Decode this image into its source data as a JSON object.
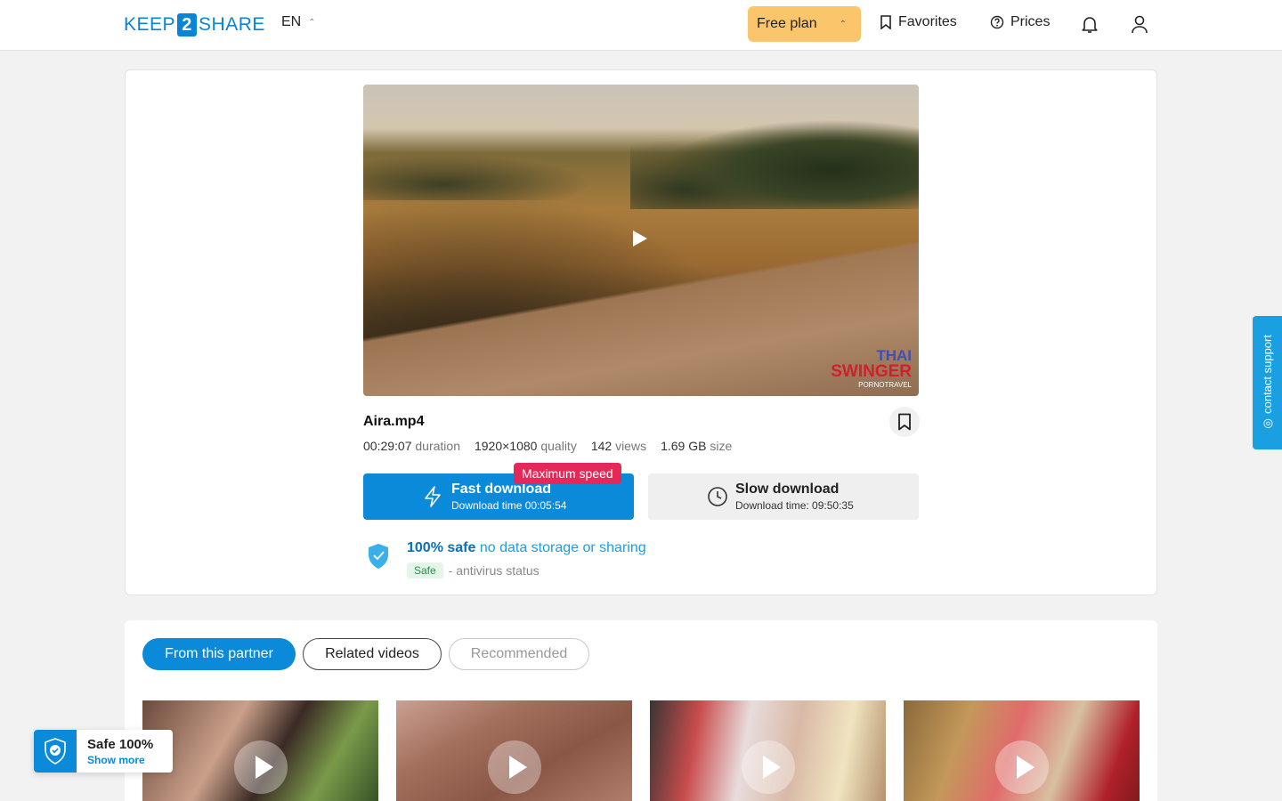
{
  "header": {
    "logo_left": "KEEP",
    "logo_mid": "2",
    "logo_right": "SHARE",
    "language": "EN",
    "plan_label": "Free plan",
    "favorites_label": "Favorites",
    "prices_label": "Prices"
  },
  "video": {
    "watermark_line1": "THAI",
    "watermark_line2": "SWINGER",
    "watermark_line3": "PORNOTRAVEL"
  },
  "file": {
    "name": "Aira.mp4",
    "duration": "00:29:07",
    "duration_label": "duration",
    "quality": "1920×1080",
    "quality_label": "quality",
    "views": "142",
    "views_label": "views",
    "size": "1.69 GB",
    "size_label": "size"
  },
  "download": {
    "badge": "Maximum speed",
    "fast_title": "Fast download",
    "fast_time": "Download time 00:05:54",
    "slow_title": "Slow download",
    "slow_time": "Download time: 09:50:35"
  },
  "safety": {
    "bold": "100% safe",
    "text": "no data storage or sharing",
    "chip": "Safe",
    "status": "- antivirus status"
  },
  "tabs": [
    {
      "label": "From this partner"
    },
    {
      "label": "Related videos"
    },
    {
      "label": "Recommended"
    }
  ],
  "widget": {
    "title": "Safe 100%",
    "link": "Show more"
  },
  "support": {
    "label": "◎ contact support"
  },
  "colors": {
    "accent": "#0a8ad8",
    "plan": "#fbc66b",
    "badge": "#e5285a"
  }
}
